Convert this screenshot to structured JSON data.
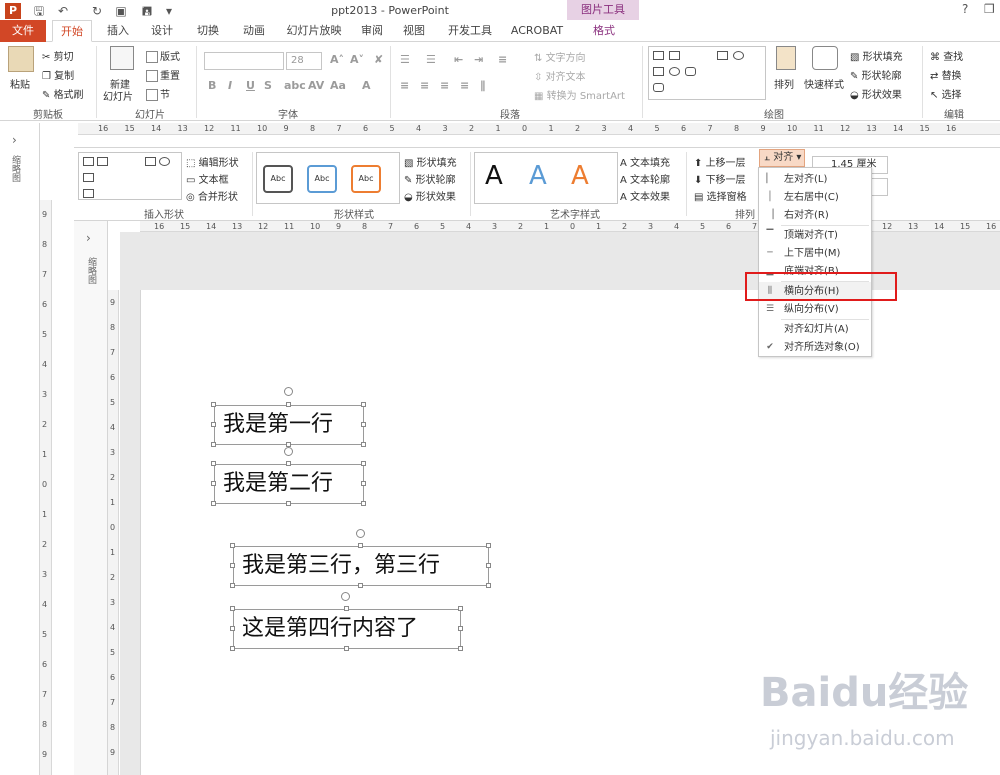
{
  "window": {
    "title": "ppt2013 - PowerPoint",
    "context_group": "图片工具",
    "help": "?"
  },
  "tabs": [
    "文件",
    "开始",
    "插入",
    "设计",
    "切换",
    "动画",
    "幻灯片放映",
    "审阅",
    "视图",
    "开发工具",
    "ACROBAT",
    "格式"
  ],
  "ribbon": {
    "clipboard": {
      "paste": "粘贴",
      "cut": "剪切",
      "copy": "复制",
      "format_painter": "格式刷",
      "label": "剪贴板"
    },
    "slides": {
      "new_slide": "新建",
      "new_slide2": "幻灯片",
      "layout": "版式",
      "reset": "重置",
      "section": "节",
      "label": "幻灯片"
    },
    "font": {
      "size": "28",
      "label": "字体"
    },
    "paragraph": {
      "text_direction": "文字方向",
      "align_text": "对齐文本",
      "smartart": "转换为 SmartArt",
      "label": "段落"
    },
    "drawing": {
      "arrange": "排列",
      "quick_styles": "快速样式",
      "shape_fill": "形状填充",
      "shape_outline": "形状轮廓",
      "shape_effects": "形状效果",
      "label": "绘图"
    },
    "editing": {
      "find": "查找",
      "replace": "替换",
      "select": "选择",
      "label": "编辑"
    }
  },
  "ribbon2": {
    "insert_shapes": {
      "edit_shape": "编辑形状",
      "text_box": "文本框",
      "merge_shapes": "合并形状",
      "label": "插入形状"
    },
    "shape_styles": {
      "abc": "Abc",
      "shape_fill": "形状填充",
      "shape_outline": "形状轮廓",
      "shape_effects": "形状效果",
      "label": "形状样式"
    },
    "wordart": {
      "a": "A",
      "text_fill": "文本填充",
      "text_outline": "文本轮廓",
      "text_effects": "文本效果",
      "label": "艺术字样式"
    },
    "arrange": {
      "bring_forward": "上移一层",
      "send_backward": "下移一层",
      "selection_pane": "选择窗格",
      "align": "对齐",
      "label": "排列"
    },
    "size": {
      "height": "1.45 厘米"
    }
  },
  "pane_label": "缩略图",
  "ruler_h1": [
    "16",
    "15",
    "14",
    "13",
    "12",
    "11",
    "10",
    "9",
    "8",
    "7",
    "6",
    "5",
    "4",
    "3",
    "2",
    "1",
    "0",
    "1",
    "2",
    "3",
    "4",
    "5",
    "6",
    "7",
    "8",
    "9",
    "10",
    "11",
    "12",
    "13",
    "14",
    "15",
    "16"
  ],
  "ruler_h2": [
    "16",
    "15",
    "14",
    "13",
    "12",
    "11",
    "10",
    "9",
    "8",
    "7",
    "6",
    "5",
    "4",
    "3",
    "2",
    "1",
    "0",
    "1",
    "2",
    "3",
    "4",
    "5",
    "6",
    "7",
    "8",
    "9",
    "10",
    "11",
    "12",
    "13",
    "14",
    "15",
    "16"
  ],
  "ruler_v1": [
    "9",
    "8",
    "7",
    "6",
    "5",
    "4",
    "3",
    "2",
    "1",
    "0",
    "1",
    "2",
    "3",
    "4",
    "5",
    "6",
    "7",
    "8",
    "9"
  ],
  "ruler_v2": [
    "9",
    "8",
    "7",
    "6",
    "5",
    "4",
    "3",
    "2",
    "1",
    "0",
    "1",
    "2",
    "3",
    "4",
    "5",
    "6",
    "7",
    "8",
    "9"
  ],
  "align_menu": {
    "items": [
      {
        "label": "左对齐(L)",
        "icon": "align-left-icon"
      },
      {
        "label": "左右居中(C)",
        "icon": "align-center-icon"
      },
      {
        "label": "右对齐(R)",
        "icon": "align-right-icon"
      },
      {
        "label": "顶端对齐(T)",
        "icon": "align-top-icon"
      },
      {
        "label": "上下居中(M)",
        "icon": "align-middle-icon"
      },
      {
        "label": "底端对齐(B)",
        "icon": "align-bottom-icon"
      },
      {
        "label": "横向分布(H)",
        "icon": "distribute-horizontal-icon"
      },
      {
        "label": "纵向分布(V)",
        "icon": "distribute-vertical-icon"
      },
      {
        "label": "对齐幻灯片(A)",
        "icon": ""
      },
      {
        "label": "对齐所选对象(O)",
        "icon": "checkmark-icon"
      }
    ],
    "highlighted": "横向分布(H)"
  },
  "slide": {
    "lines": [
      "我是第一行",
      "我是第二行",
      "我是第三行，第三行",
      "这是第四行内容了"
    ]
  },
  "watermark": {
    "brand": "Baidu经验",
    "url": "jingyan.baidu.com"
  },
  "colors": {
    "accent": "#d24726",
    "context": "#8a2f7e",
    "highlight_box": "#e01b1b"
  }
}
